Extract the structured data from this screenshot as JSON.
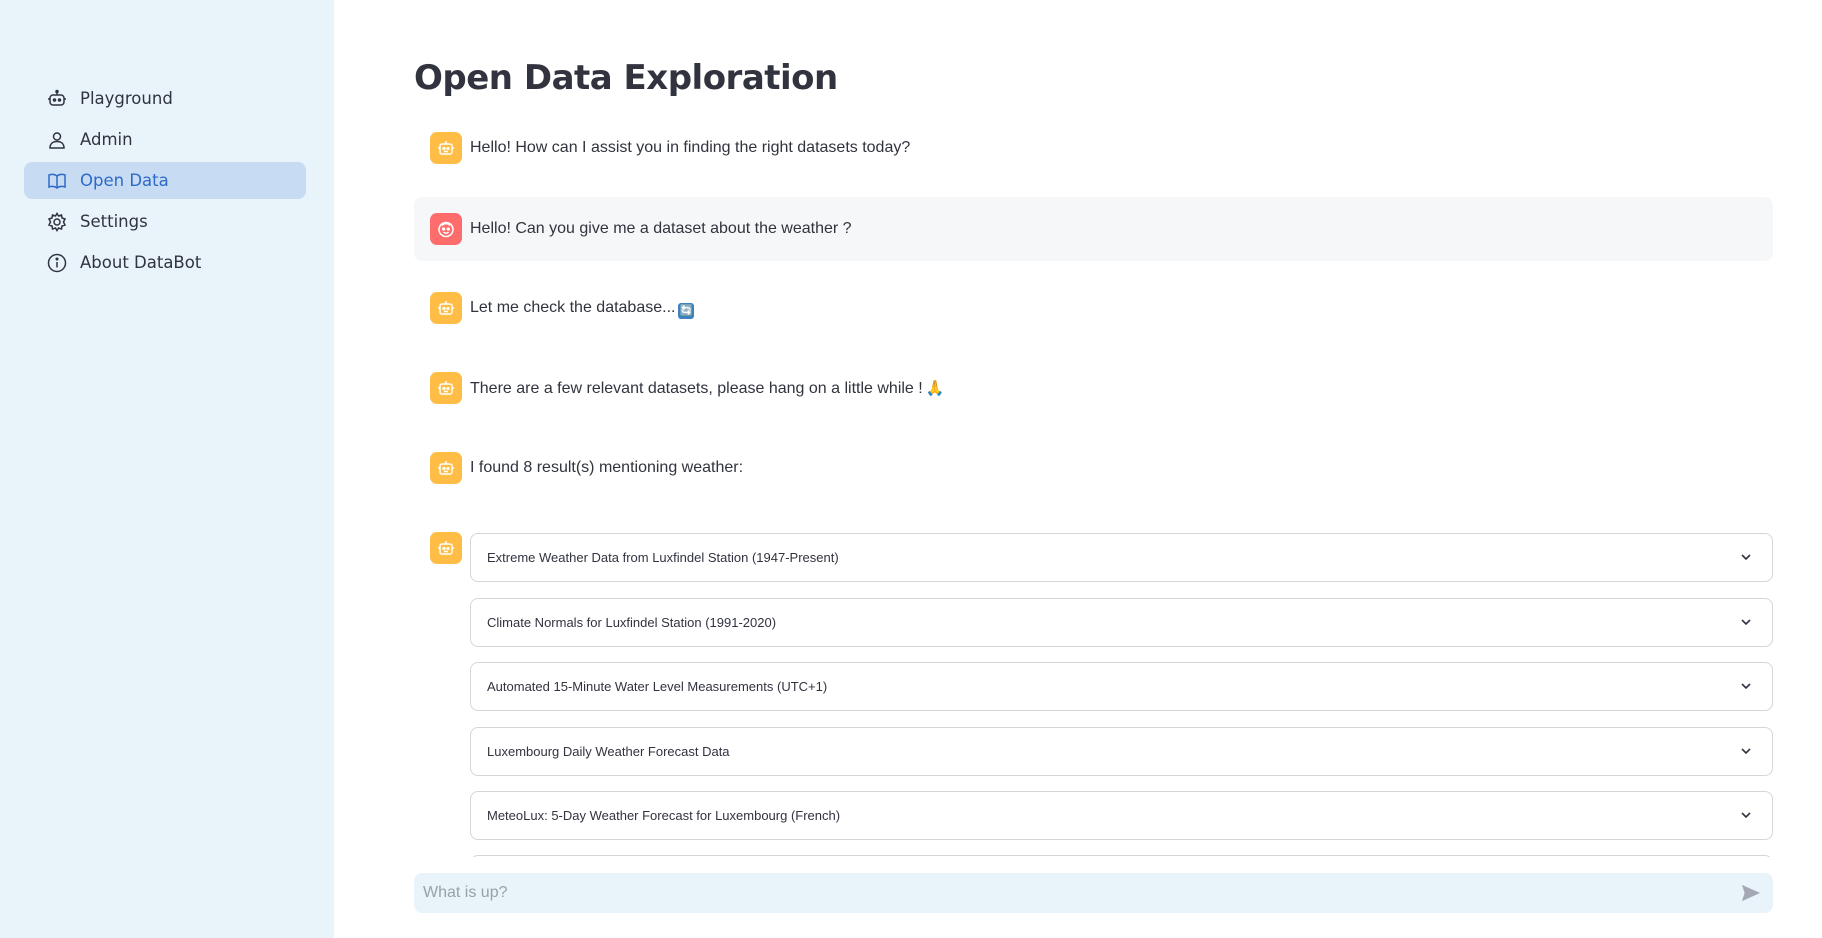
{
  "sidebar": {
    "items": [
      {
        "label": "Playground",
        "icon": "robot-icon",
        "active": false
      },
      {
        "label": "Admin",
        "icon": "person-icon",
        "active": false
      },
      {
        "label": "Open Data",
        "icon": "book-icon",
        "active": true
      },
      {
        "label": "Settings",
        "icon": "gear-icon",
        "active": false
      },
      {
        "label": "About DataBot",
        "icon": "info-icon",
        "active": false
      }
    ]
  },
  "main": {
    "title": "Open Data Exploration",
    "messages": [
      {
        "role": "assistant",
        "avatar": "robot-icon",
        "text": "Hello! How can I assist you in finding the right datasets today?"
      },
      {
        "role": "user",
        "avatar": "face-icon",
        "text": "Hello! Can you give me a dataset about the weather ?"
      },
      {
        "role": "assistant",
        "avatar": "robot-icon",
        "text": "Let me check the database...",
        "emoji": "🔄"
      },
      {
        "role": "assistant",
        "avatar": "robot-icon",
        "text": "There are a few relevant datasets, please hang on a little while !",
        "emoji": "🙏"
      },
      {
        "role": "assistant",
        "avatar": "robot-icon",
        "text": "I found 8 result(s) mentioning weather:"
      }
    ],
    "results": [
      "Extreme Weather Data from Luxfindel Station (1947-Present)",
      "Climate Normals for Luxfindel Station (1991-2020)",
      "Automated 15-Minute Water Level Measurements (UTC+1)",
      "Luxembourg Daily Weather Forecast Data",
      "MeteoLux: 5-Day Weather Forecast for Luxembourg (French)"
    ]
  },
  "chat_input": {
    "placeholder": "What is up?",
    "value": ""
  },
  "colors": {
    "sidebar_bg": "#e8f4fa",
    "active_item_bg": "#c7dcf3",
    "active_item_text": "#2f69c8",
    "bot_avatar": "#ffbd45",
    "user_avatar": "#ff6c6c",
    "user_msg_bg": "#f5f7f9"
  }
}
